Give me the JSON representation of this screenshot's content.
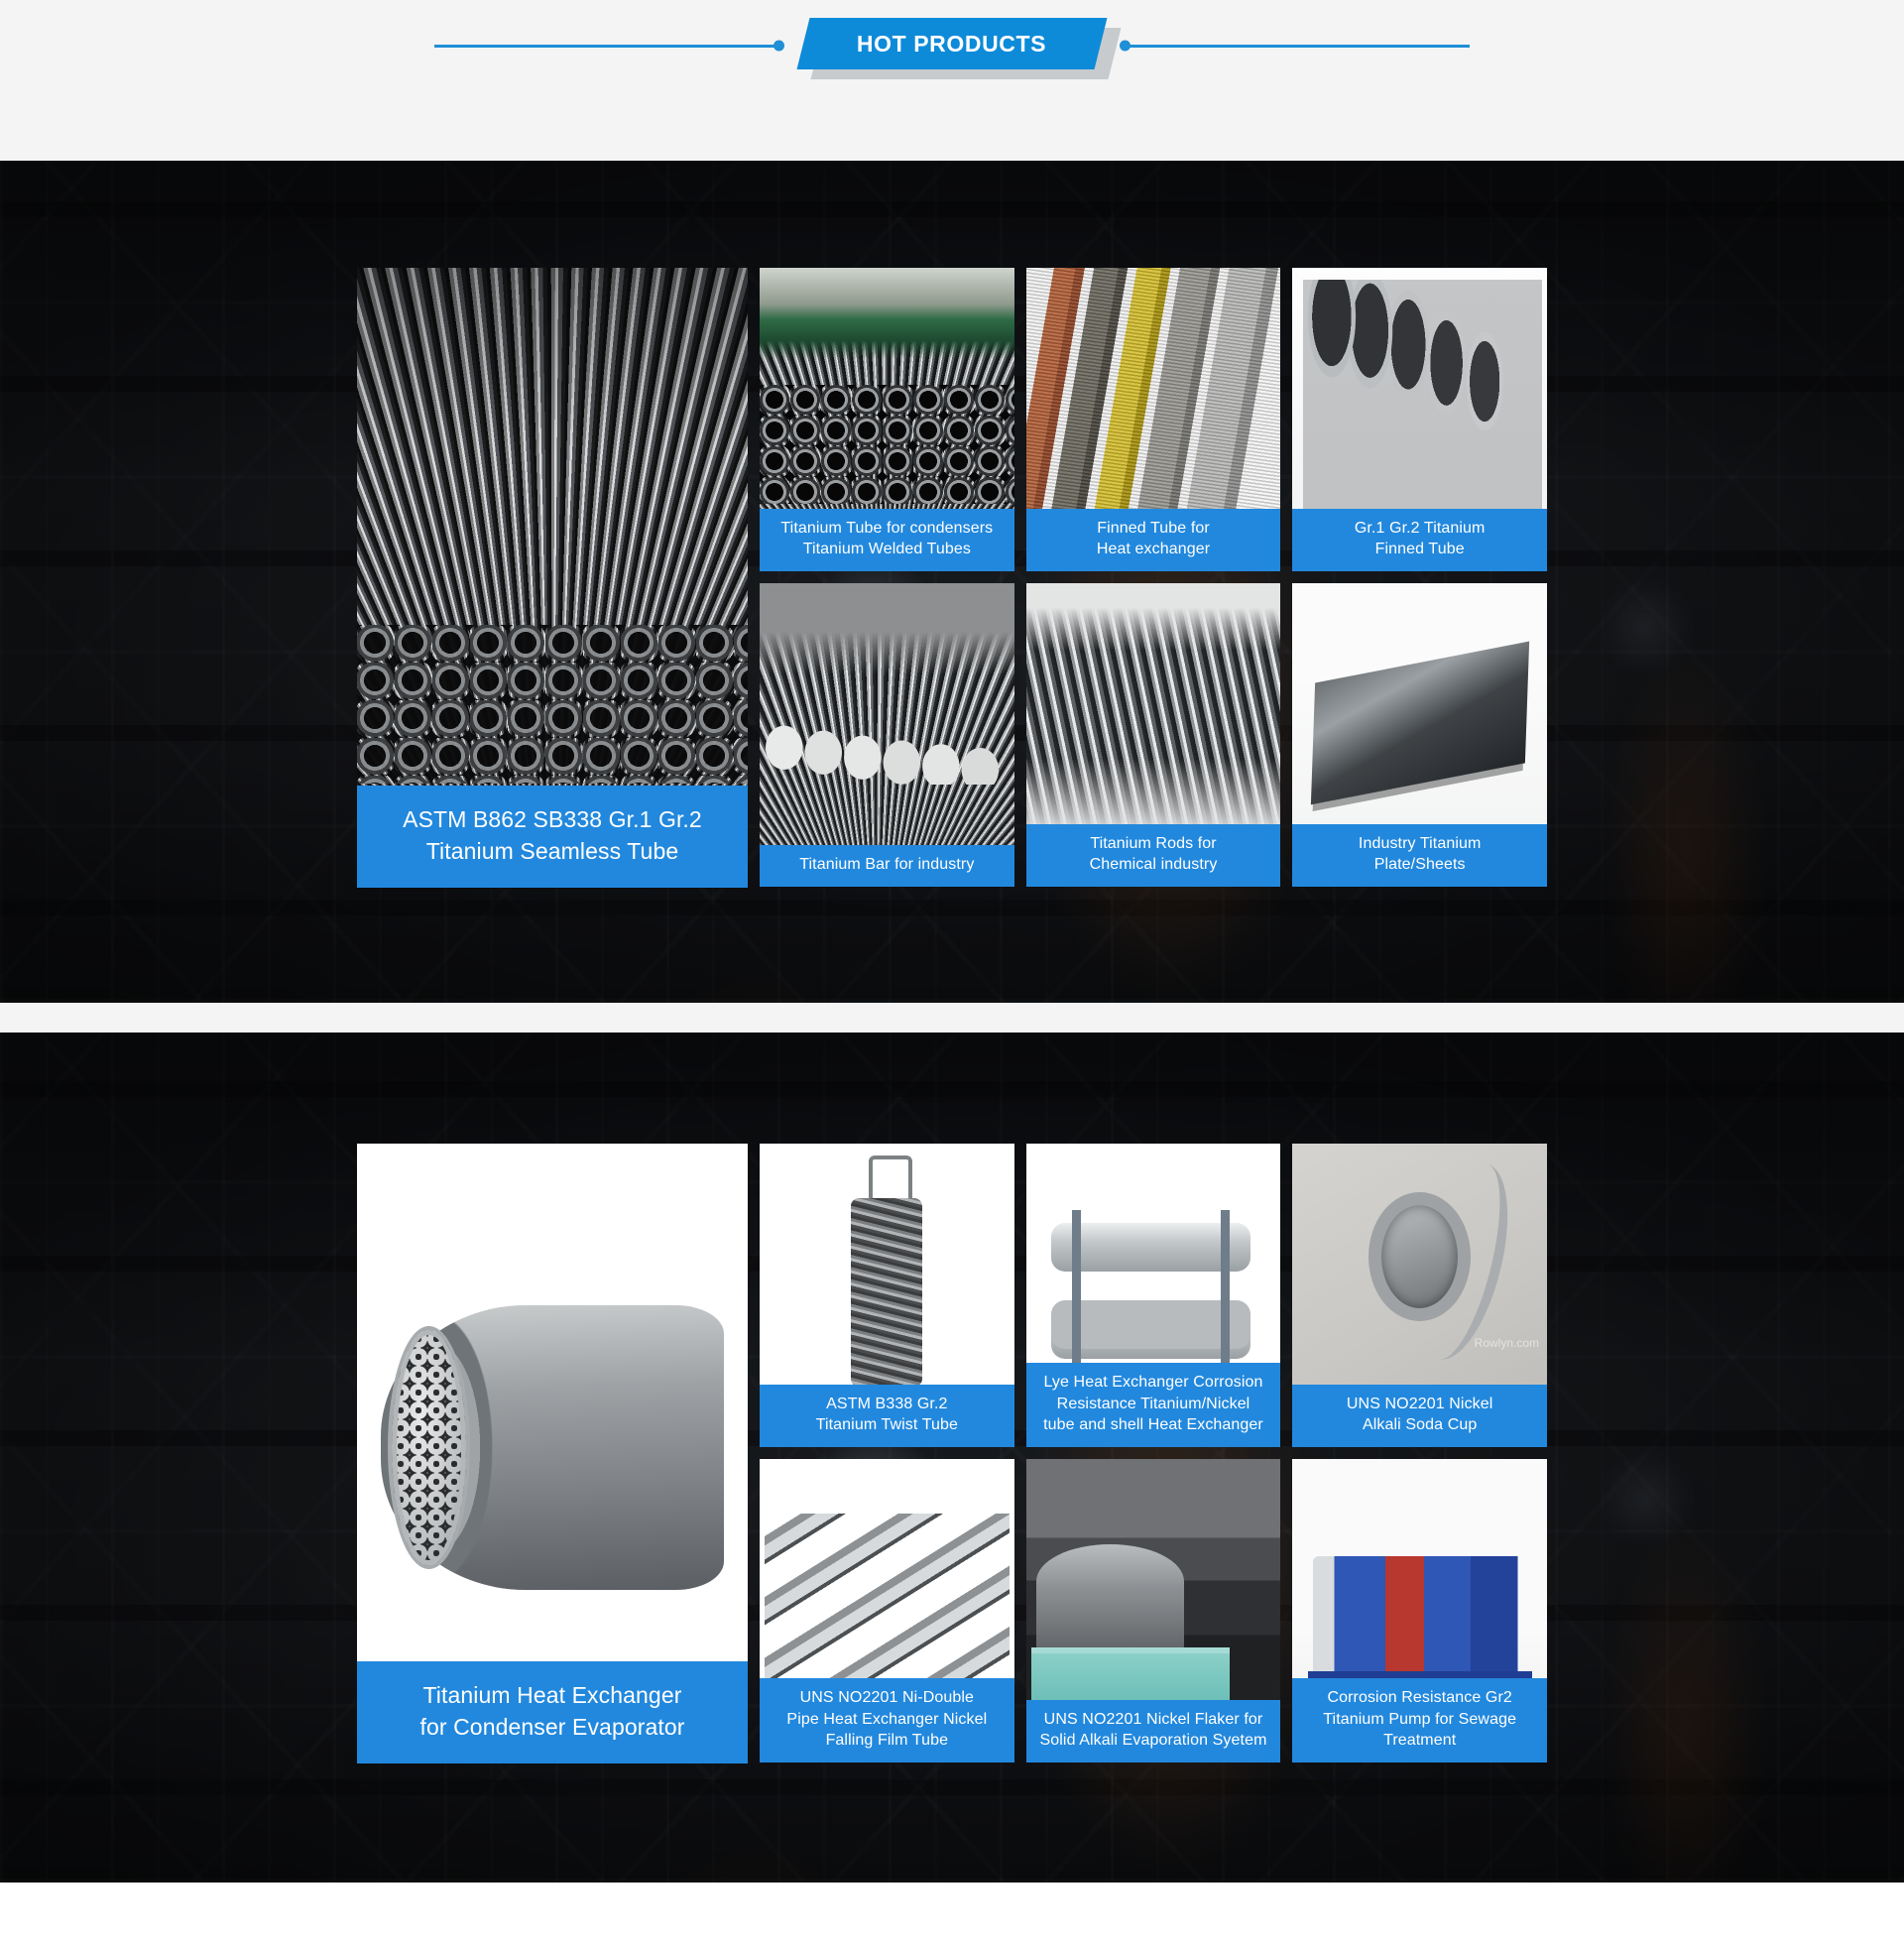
{
  "header": {
    "title": "HOT PRODUCTS"
  },
  "sections": [
    {
      "id": "hot-products-titanium",
      "feature": {
        "caption": "ASTM B862 SB338 Gr.1 Gr.2\nTitanium Seamless Tube"
      },
      "cards": [
        {
          "caption": "Titanium Tube for condensers\nTitanium Welded Tubes"
        },
        {
          "caption": "Finned Tube for\nHeat exchanger"
        },
        {
          "caption": "Gr.1 Gr.2 Titanium\nFinned Tube"
        },
        {
          "caption": "Titanium Bar for industry"
        },
        {
          "caption": "Titanium Rods for\nChemical industry"
        },
        {
          "caption": "Industry Titanium\nPlate/Sheets"
        }
      ]
    },
    {
      "id": "hot-products-heat-exchanger",
      "feature": {
        "caption": "Titanium Heat Exchanger\nfor Condenser Evaporator"
      },
      "cards": [
        {
          "caption": "ASTM B338 Gr.2\nTitanium Twist Tube"
        },
        {
          "caption": "Lye Heat Exchanger Corrosion\nResistance Titanium/Nickel\ntube and shell Heat Exchanger"
        },
        {
          "caption": "UNS NO2201 Nickel\nAlkali Soda Cup",
          "watermark": "Rowlyn.com"
        },
        {
          "caption": "UNS NO2201 Ni-Double\nPipe Heat Exchanger Nickel\nFalling Film Tube"
        },
        {
          "caption": "UNS NO2201 Nickel Flaker for\nSolid Alkali Evaporation Syetem"
        },
        {
          "caption": "Corrosion Resistance Gr2\nTitanium Pump for Sewage\nTreatment"
        }
      ]
    }
  ],
  "colors": {
    "accent_blue": "#2288dd",
    "banner_blue": "#0d8bd9",
    "banner_shadow": "#c8cbcd",
    "header_band": "#f4f4f4",
    "caption_text": "#ffffff"
  }
}
